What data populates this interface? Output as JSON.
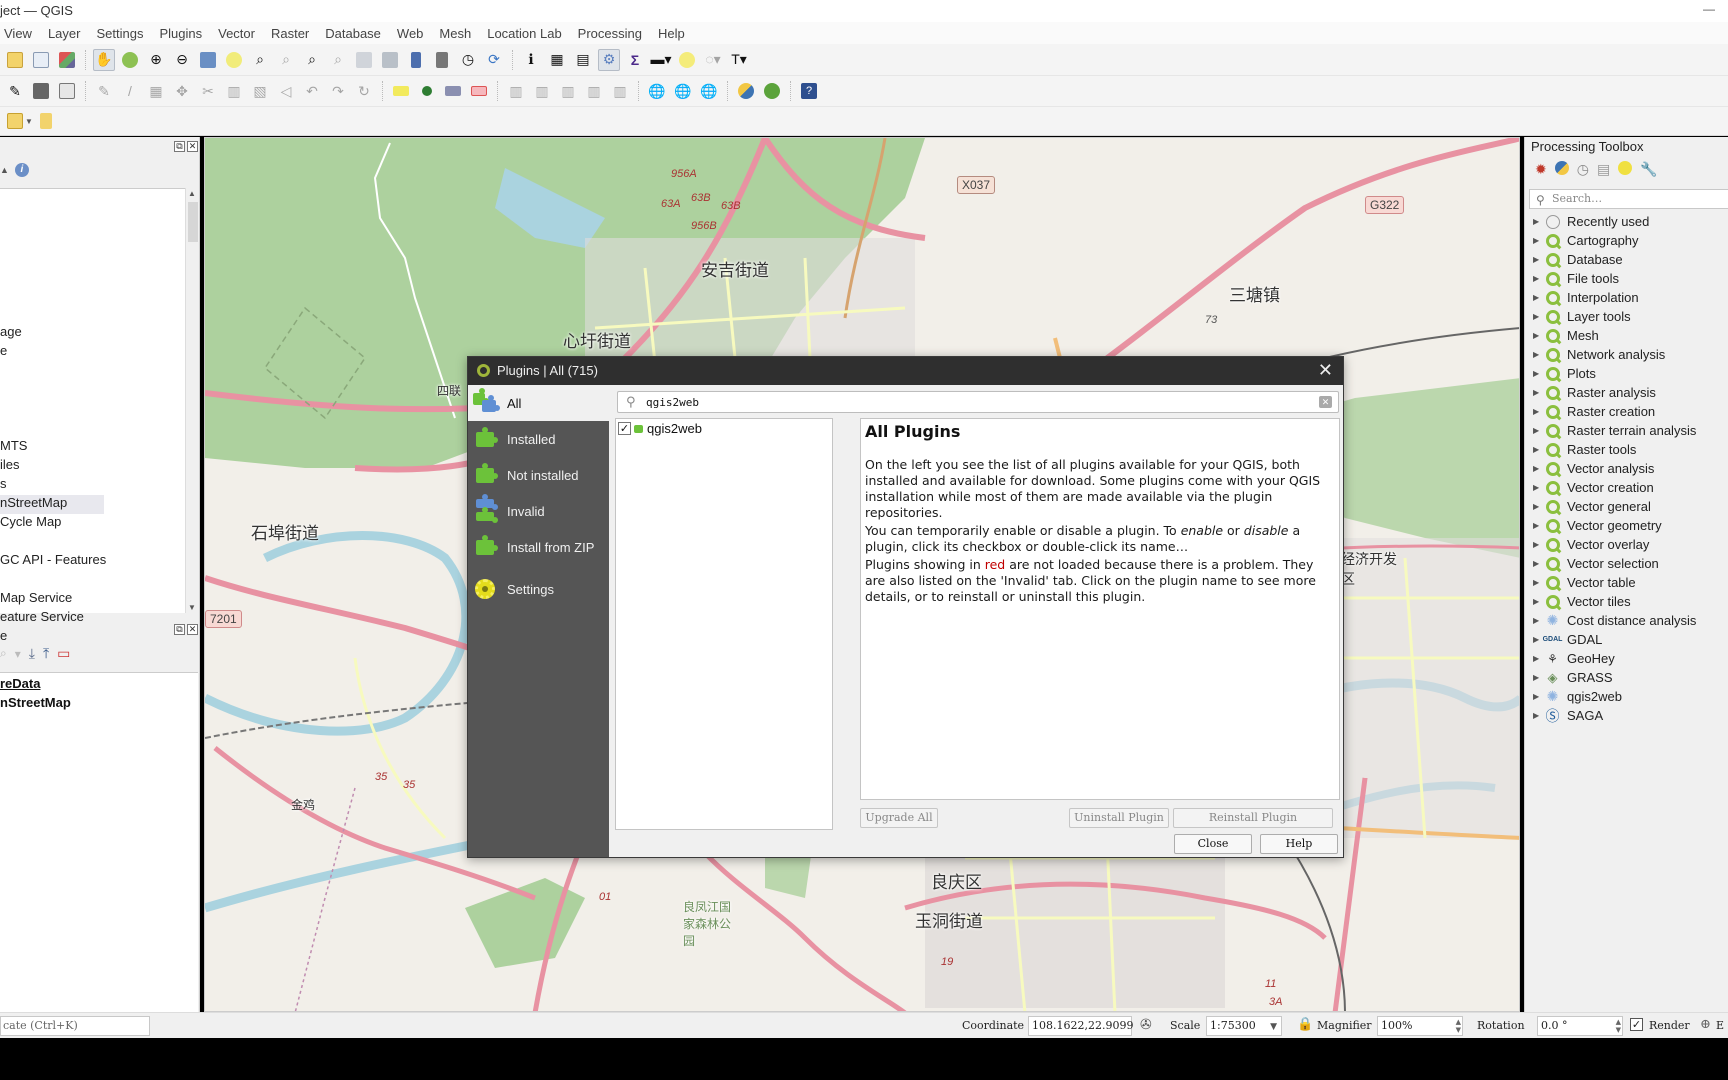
{
  "window": {
    "title": "ject — QGIS"
  },
  "menubar": {
    "items": [
      "View",
      "Layer",
      "Settings",
      "Plugins",
      "Vector",
      "Raster",
      "Database",
      "Web",
      "Mesh",
      "Location Lab",
      "Processing",
      "Help"
    ]
  },
  "browser_panel": {
    "items": [
      {
        "label": "age"
      },
      {
        "label": "e"
      },
      {
        "label": "MTS"
      },
      {
        "label": "iles"
      },
      {
        "label": "s"
      },
      {
        "label": "nStreetMap",
        "selected": true
      },
      {
        "label": " Cycle Map"
      },
      {
        "label": "GC API - Features"
      },
      {
        "label": "Map Service"
      },
      {
        "label": "eature Service"
      },
      {
        "label": "e"
      }
    ]
  },
  "layers_panel": {
    "layers": [
      {
        "label": "reData",
        "type": "group"
      },
      {
        "label": "nStreetMap",
        "type": "layer"
      }
    ]
  },
  "map": {
    "labels": [
      {
        "text": "安吉街道"
      },
      {
        "text": "心圩街道"
      },
      {
        "text": "三塘镇"
      },
      {
        "text": "石埠街道"
      },
      {
        "text": "四联"
      },
      {
        "text": "金鸡"
      },
      {
        "text": "良庆区"
      },
      {
        "text": "玉洞街道"
      },
      {
        "text": "良凤江国家森林公园"
      },
      {
        "text": "经济开发区"
      }
    ],
    "road_shields": [
      "X037",
      "G322",
      "7201"
    ],
    "road_numbers": [
      "956A",
      "63A",
      "63B",
      "63B",
      "956B",
      "73",
      "35",
      "35",
      "01",
      "19",
      "11",
      "3A"
    ]
  },
  "processing_toolbox": {
    "title": "Processing Toolbox",
    "search_placeholder": "Search…",
    "items": [
      {
        "label": "Recently used",
        "icon": "clock"
      },
      {
        "label": "Cartography",
        "icon": "qgis"
      },
      {
        "label": "Database",
        "icon": "qgis"
      },
      {
        "label": "File tools",
        "icon": "qgis"
      },
      {
        "label": "Interpolation",
        "icon": "qgis"
      },
      {
        "label": "Layer tools",
        "icon": "qgis"
      },
      {
        "label": "Mesh",
        "icon": "qgis"
      },
      {
        "label": "Network analysis",
        "icon": "qgis"
      },
      {
        "label": "Plots",
        "icon": "qgis"
      },
      {
        "label": "Raster analysis",
        "icon": "qgis"
      },
      {
        "label": "Raster creation",
        "icon": "qgis"
      },
      {
        "label": "Raster terrain analysis",
        "icon": "qgis"
      },
      {
        "label": "Raster tools",
        "icon": "qgis"
      },
      {
        "label": "Vector analysis",
        "icon": "qgis"
      },
      {
        "label": "Vector creation",
        "icon": "qgis"
      },
      {
        "label": "Vector general",
        "icon": "qgis"
      },
      {
        "label": "Vector geometry",
        "icon": "qgis"
      },
      {
        "label": "Vector overlay",
        "icon": "qgis"
      },
      {
        "label": "Vector selection",
        "icon": "qgis"
      },
      {
        "label": "Vector table",
        "icon": "qgis"
      },
      {
        "label": "Vector tiles",
        "icon": "qgis"
      },
      {
        "label": "Cost distance analysis",
        "icon": "gear"
      },
      {
        "label": "GDAL",
        "icon": "gdal"
      },
      {
        "label": "GeoHey",
        "icon": "geohey"
      },
      {
        "label": "GRASS",
        "icon": "grass"
      },
      {
        "label": "qgis2web",
        "icon": "gear"
      },
      {
        "label": "SAGA",
        "icon": "saga"
      }
    ]
  },
  "statusbar": {
    "locate_placeholder": "cate (Ctrl+K)",
    "coordinate_label": "Coordinate",
    "coordinate_value": "108.1622,22.9099",
    "scale_label": "Scale",
    "scale_value": "1:75300",
    "magnifier_label": "Magnifier",
    "magnifier_value": "100%",
    "rotation_label": "Rotation",
    "rotation_value": "0.0 °",
    "render_label": "Render",
    "render_checked": true,
    "epsg_partial": "E"
  },
  "plugins_dialog": {
    "title": "Plugins | All (715)",
    "sidebar": [
      {
        "label": "All",
        "active": true
      },
      {
        "label": "Installed"
      },
      {
        "label": "Not installed"
      },
      {
        "label": "Invalid"
      },
      {
        "label": "Install from ZIP"
      },
      {
        "label": "Settings"
      }
    ],
    "search_value": "qgis2web",
    "plugins": [
      {
        "name": "qgis2web",
        "checked": true
      }
    ],
    "details": {
      "heading": "All Plugins",
      "p1": "On the left you see the list of all plugins available for your QGIS, both installed and available for download. Some plugins come with your QGIS installation while most of them are made available via the plugin repositories.",
      "p2_a": "You can temporarily enable or disable a plugin. To ",
      "p2_enable": "enable",
      "p2_or": " or ",
      "p2_disable": "disable",
      "p2_b": " a plugin, click its checkbox or double-click its name…",
      "p3_a": "Plugins showing in ",
      "p3_red": "red",
      "p3_b": " are not loaded because there is a problem. They are also listed on the 'Invalid' tab. Click on the plugin name to see more details, or to reinstall or uninstall this plugin."
    },
    "buttons": {
      "upgrade_all": "Upgrade All",
      "uninstall": "Uninstall Plugin",
      "reinstall": "Reinstall Plugin",
      "close": "Close",
      "help": "Help"
    }
  }
}
